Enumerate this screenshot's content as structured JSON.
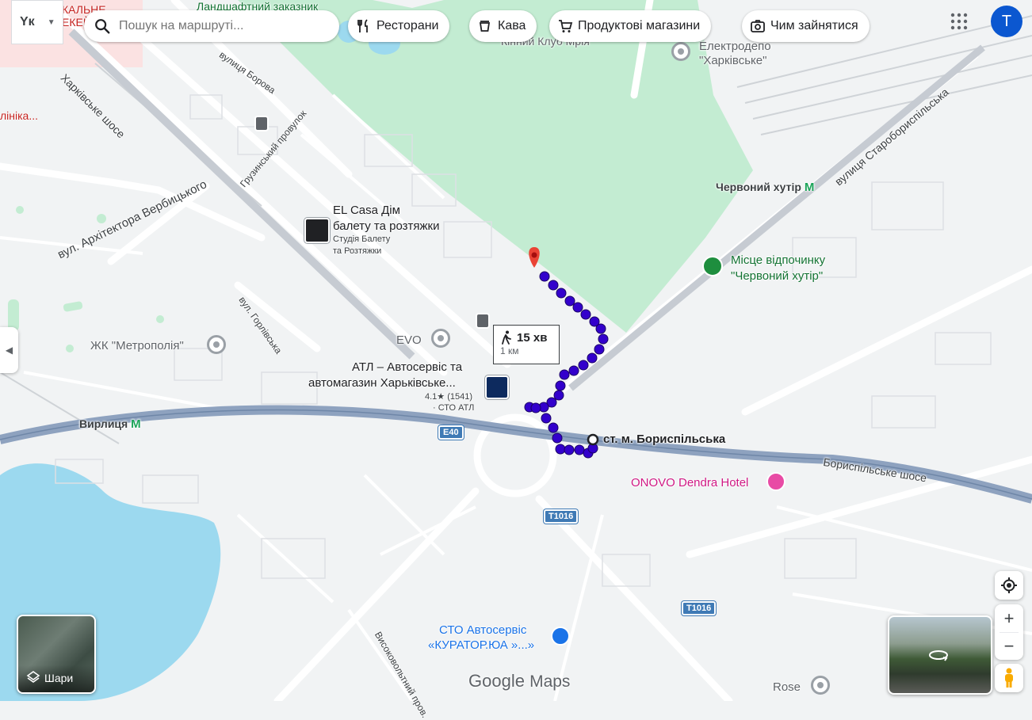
{
  "search": {
    "placeholder": "Пошук на маршруті..."
  },
  "lang_toggle": {
    "label": "Yк"
  },
  "chips": [
    {
      "label": "Ресторани",
      "icon": "fork-knife-icon"
    },
    {
      "label": "Кава",
      "icon": "coffee-cup-icon"
    },
    {
      "label": "Продуктові магазини",
      "icon": "shopping-cart-icon"
    },
    {
      "label": "Чим зайнятися",
      "icon": "camera-icon"
    }
  ],
  "account": {
    "initial": "T",
    "color": "#0b57d0"
  },
  "route": {
    "duration": "15 хв",
    "distance": "1 км",
    "origin_label": "ст. м. Бориспільська",
    "color": "#3300cc"
  },
  "places": {
    "el_casa_title_line1": "EL Casa Дім",
    "el_casa_title_line2": "балету та розтяжки",
    "el_casa_sub_line1": "Студія Балету",
    "el_casa_sub_line2": "та Розтяжки",
    "evo": "EVO",
    "atl_line1": "АТЛ – Автосервіс та",
    "atl_line2": "автомагазин Харьківське...",
    "atl_rating": "4.1★ (1541)",
    "atl_category": "· СТО АТЛ",
    "metropol": "ЖК \"Метрополія\"",
    "rest_line1": "Місце відпочинку",
    "rest_line2": "\"Червоний хутір\"",
    "onovo": "ONOVO Dendra Hotel",
    "sto_line1": "СТО Автосервіс",
    "sto_line2": "«КУРАТОР.ЮА »...»",
    "rose": "Rose",
    "depot_line1": "Електродепо",
    "depot_line2": "\"Харківське\"",
    "kinny_klub": "Кінний Клуб Мрія",
    "landscape": "Ландшафтний заказник",
    "clinic_partial": "лініка...",
    "top_left_red": "КАЛЬНЕ",
    "top_left_red2": "ЕКЕЙНЕ"
  },
  "streets": {
    "kharkivske": "Харківське шосе",
    "borova": "вулиця Борова",
    "gruzynskyi": "Грузинський провулок",
    "verbytskoho": "вул. Архітектора Вербицького",
    "horlivska": "вул. Горлівська",
    "starobory": "вулиця Старобориспільська",
    "boryspilske": "Бориспільське шосе",
    "vysokovoltnyi": "Високовольтний пров."
  },
  "metro": {
    "chervonyi": "Червоний хутір",
    "vyrlytsia": "Вирлиця",
    "symbol": "M"
  },
  "shields": {
    "e40": "E40",
    "t1016": "T1016",
    "t1016b": "T1016"
  },
  "layers": {
    "label": "Шари"
  },
  "logo": {
    "google": "Google",
    "maps": "Maps"
  },
  "colors": {
    "water": "#9cd9ef",
    "park": "#c3ecd2",
    "road": "#ffffff",
    "highway": "#8ea2bf"
  }
}
